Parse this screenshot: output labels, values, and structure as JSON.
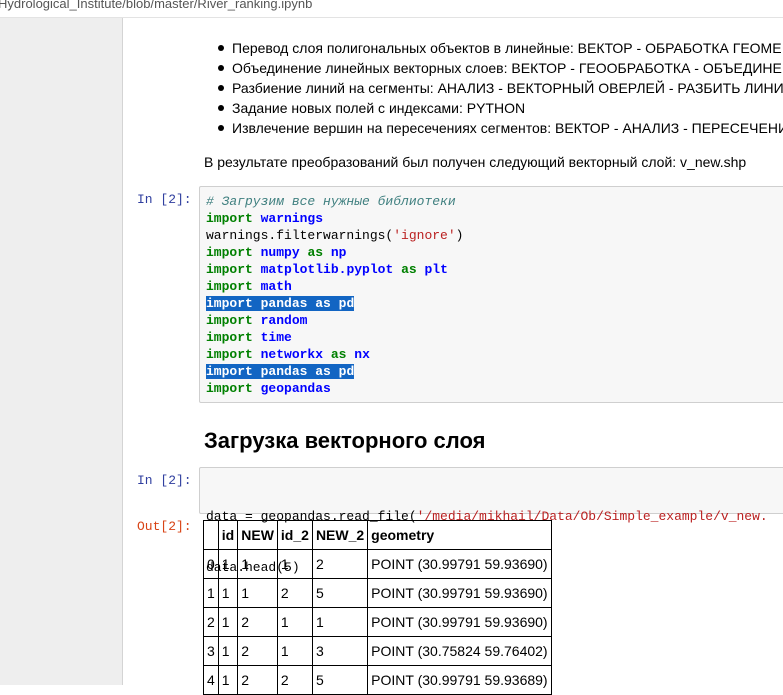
{
  "browser": {
    "url": "Hydrological_Institute/blob/master/River_ranking.ipynb"
  },
  "markdown": {
    "bullets": [
      "Перевод слоя полигональных объектов в линейные: ВЕКТОР - ОБРАБОТКА ГЕОМЕ",
      "Объединение линейных векторных слоев: ВЕКТОР - ГЕООБРАБОТКА - ОБЪЕДИНЕ",
      "Разбиение линий на сегменты: АНАЛИЗ - ВЕКТОРНЫЙ ОВЕРЛЕЙ - РАЗБИТЬ ЛИНИЯ",
      "Задание новых полей с индексами: PYTHON",
      "Извлечение вершин на пересечениях сегментов: ВЕКТОР - АНАЛИЗ - ПЕРЕСЕЧЕНИ"
    ],
    "result_text": "В результате преобразований был получен следующий векторный слой: v_new.shp"
  },
  "cell1": {
    "prompt": "In [2]:",
    "lines": [
      {
        "type": "comment",
        "text": "# Загрузим все нужные библиотеки"
      },
      {
        "type": "import",
        "kw": "import",
        "mod": "warnings"
      },
      {
        "type": "call",
        "pre": "warnings.filterwarnings(",
        "str": "'ignore'",
        "post": ")"
      },
      {
        "type": "import",
        "kw": "import",
        "mod": "numpy",
        "as": "as",
        "alias": "np"
      },
      {
        "type": "import",
        "kw": "import",
        "mod": "matplotlib.pyplot",
        "as": "as",
        "alias": "plt"
      },
      {
        "type": "import",
        "kw": "import",
        "mod": "math"
      },
      {
        "type": "import",
        "kw": "import",
        "mod": "pandas",
        "as": "as",
        "alias": "pd",
        "highlight": true
      },
      {
        "type": "import",
        "kw": "import",
        "mod": "random"
      },
      {
        "type": "import",
        "kw": "import",
        "mod": "time"
      },
      {
        "type": "import",
        "kw": "import",
        "mod": "networkx",
        "as": "as",
        "alias": "nx"
      },
      {
        "type": "import",
        "kw": "import",
        "mod": "pandas",
        "as": "as",
        "alias": "pd",
        "highlight": true
      },
      {
        "type": "import",
        "kw": "import",
        "mod": "geopandas"
      }
    ]
  },
  "heading": "Загрузка векторного слоя",
  "cell2": {
    "prompt": "In [2]:",
    "line1_pre": "data = geopandas.read_file(",
    "line1_str": "'/media/mikhail/Data/Ob/Simple_example/v_new.",
    "line2": "data.head(5)"
  },
  "output": {
    "prompt": "Out[2]:",
    "columns": [
      "",
      "id",
      "NEW",
      "id_2",
      "NEW_2",
      "geometry"
    ],
    "rows": [
      [
        "0",
        "1",
        "1",
        "1",
        "2",
        "POINT (30.99791 59.93690)"
      ],
      [
        "1",
        "1",
        "1",
        "2",
        "5",
        "POINT (30.99791 59.93690)"
      ],
      [
        "2",
        "1",
        "2",
        "1",
        "1",
        "POINT (30.99791 59.93690)"
      ],
      [
        "3",
        "1",
        "2",
        "1",
        "3",
        "POINT (30.75824 59.76402)"
      ],
      [
        "4",
        "1",
        "2",
        "2",
        "5",
        "POINT (30.99791 59.93689)"
      ]
    ]
  }
}
